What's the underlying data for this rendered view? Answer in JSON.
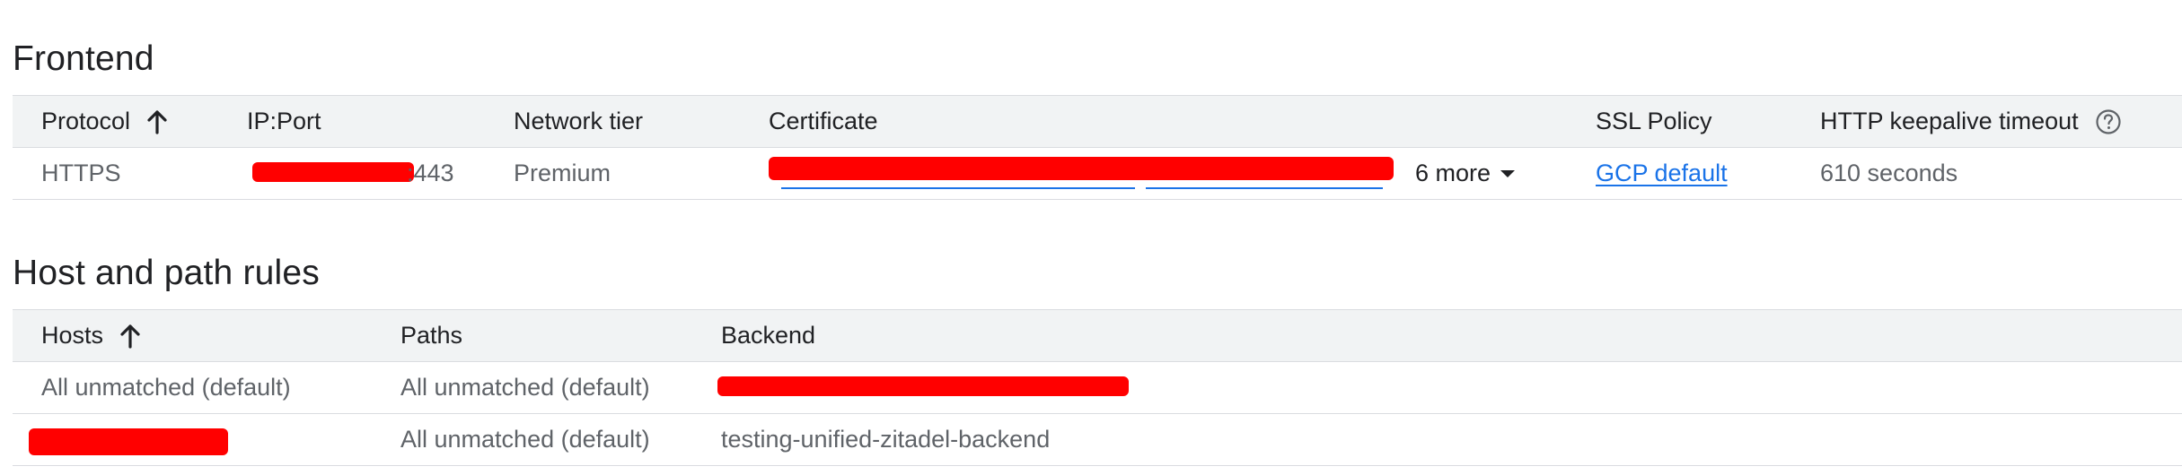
{
  "frontend": {
    "title": "Frontend",
    "columns": {
      "protocol": "Protocol",
      "ip_port": "IP:Port",
      "network_tier": "Network tier",
      "certificate": "Certificate",
      "ssl_policy": "SSL Policy",
      "keepalive": "HTTP keepalive timeout"
    },
    "row": {
      "protocol": "HTTPS",
      "ip_port_suffix": ":443",
      "network_tier": "Premium",
      "cert_more": "6 more",
      "ssl_policy": "GCP default",
      "keepalive": "610 seconds"
    }
  },
  "host_path_rules": {
    "title": "Host and path rules",
    "columns": {
      "hosts": "Hosts",
      "paths": "Paths",
      "backend": "Backend"
    },
    "rows": [
      {
        "hosts": "All unmatched (default)",
        "paths": "All unmatched (default)",
        "backend": ""
      },
      {
        "hosts": "",
        "paths": "All unmatched (default)",
        "backend": "testing-unified-zitadel-backend"
      }
    ]
  },
  "colors": {
    "link": "#1a73e8",
    "header_bg": "#f1f3f4",
    "border": "#dadce0",
    "redaction": "#ff0000"
  },
  "icons": {
    "sort": "arrow-up-icon",
    "help": "help-circle-icon",
    "dropdown": "caret-down-icon"
  }
}
